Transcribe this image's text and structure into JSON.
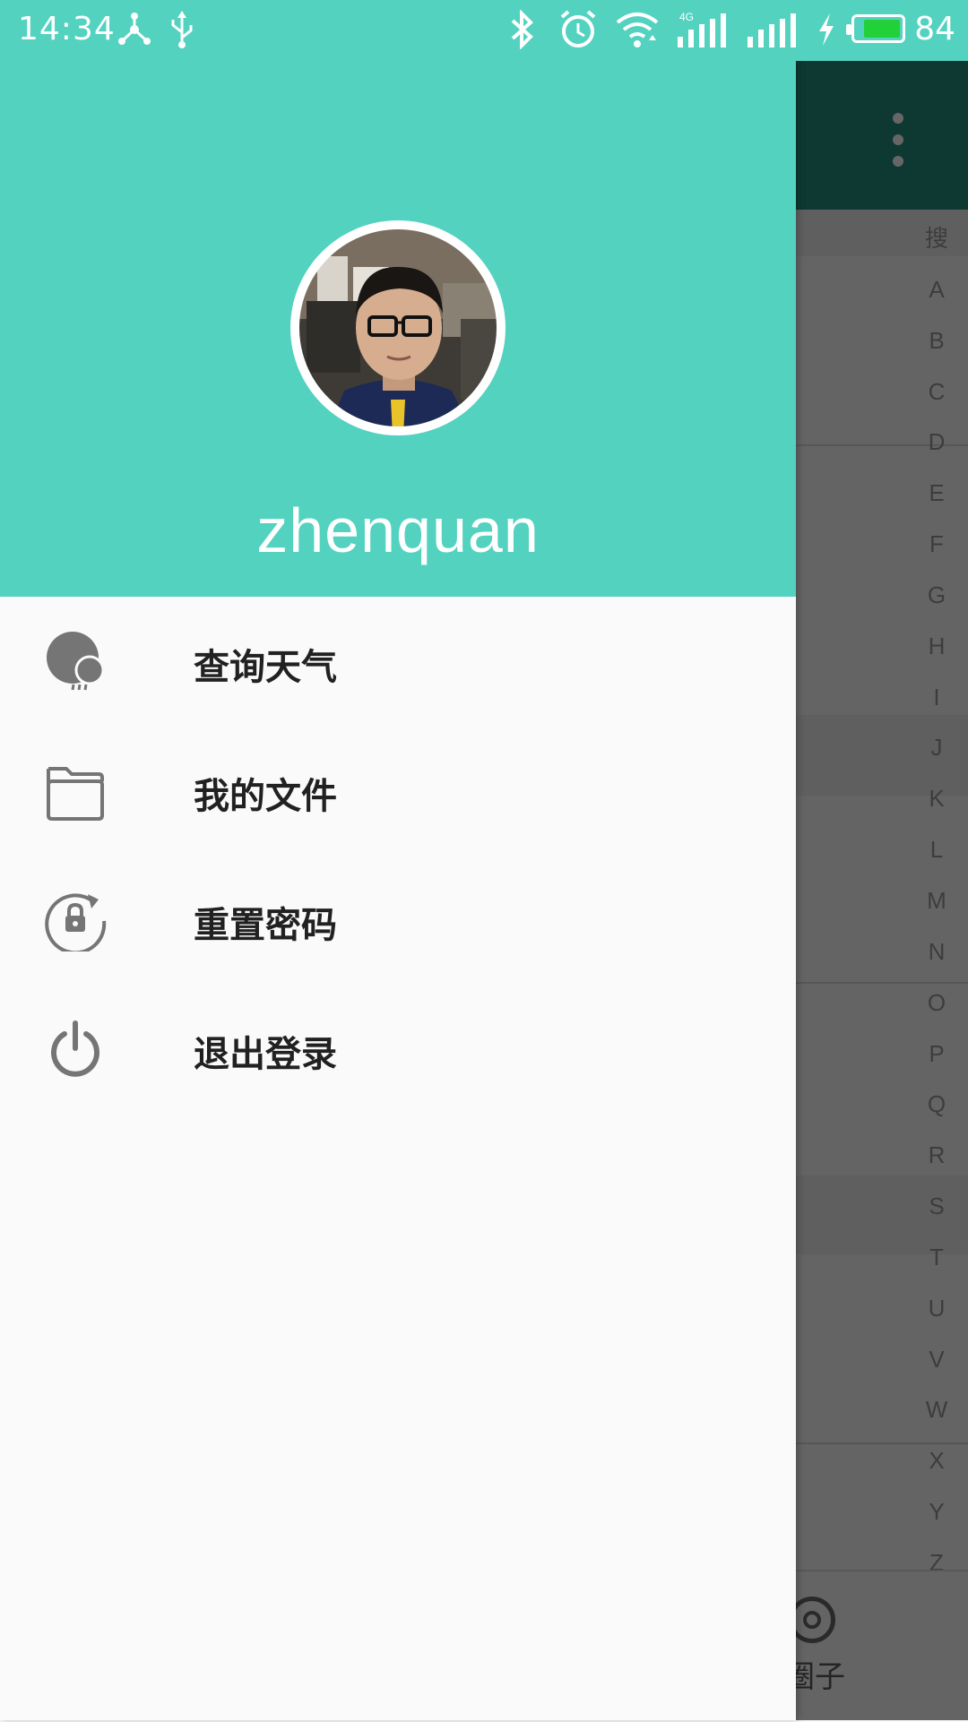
{
  "status_bar": {
    "time": "14:34",
    "battery_percent": "84",
    "battery_level": 0.84,
    "icons": [
      "share-node-icon",
      "usb-icon",
      "bluetooth-icon",
      "alarm-icon",
      "wifi-icon",
      "signal-4g-icon",
      "signal-icon",
      "charging-icon",
      "battery-icon"
    ],
    "network_label": "4G"
  },
  "drawer": {
    "username": "zhenquan",
    "header_color": "#53d2c0",
    "menu_items": [
      {
        "label": "查询天气",
        "icon": "weather-icon"
      },
      {
        "label": "我的文件",
        "icon": "folder-icon"
      },
      {
        "label": "重置密码",
        "icon": "reset-lock-icon"
      },
      {
        "label": "退出登录",
        "icon": "power-icon"
      }
    ]
  },
  "background": {
    "toolbar_color": "#238e80",
    "index_letters": [
      "搜",
      "A",
      "B",
      "C",
      "D",
      "E",
      "F",
      "G",
      "H",
      "I",
      "J",
      "K",
      "L",
      "M",
      "N",
      "O",
      "P",
      "Q",
      "R",
      "S",
      "T",
      "U",
      "V",
      "W",
      "X",
      "Y",
      "Z"
    ],
    "bottom_tab_label": "圈子"
  }
}
